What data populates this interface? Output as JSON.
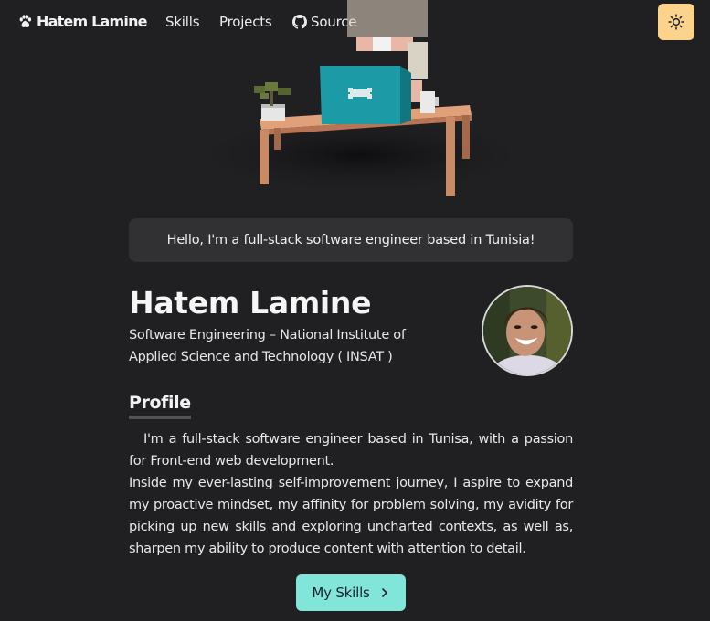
{
  "nav": {
    "brand": "Hatem Lamine",
    "links": [
      {
        "label": "Skills"
      },
      {
        "label": "Projects"
      },
      {
        "label": "Source",
        "icon": "github-icon"
      }
    ],
    "theme_toggle_icon": "sun-icon"
  },
  "greeting": "Hello, I'm a full-stack software engineer based in Tunisia!",
  "profile": {
    "name": "Hatem Lamine",
    "subtitle": "Software Engineering – National Institute of Applied Science and Technology ( INSAT )"
  },
  "section": {
    "title": "Profile",
    "bio_1": "I'm a full-stack software engineer based in Tunisa, with a passion for Front-end web development.",
    "bio_2": "Inside my ever-lasting self-improvement journey, I aspire to expand my proactive mindset, my affinity for problem solving, my avidity for picking up new skills and exploring uncharted contexts, as well as, sharpen my ability to produce content with attention to detail."
  },
  "cta": {
    "label": "My Skills",
    "icon": "chevron-right-icon"
  },
  "colors": {
    "background": "#202023",
    "accent": "#81e6d9",
    "theme_button": "#fbd38d"
  }
}
